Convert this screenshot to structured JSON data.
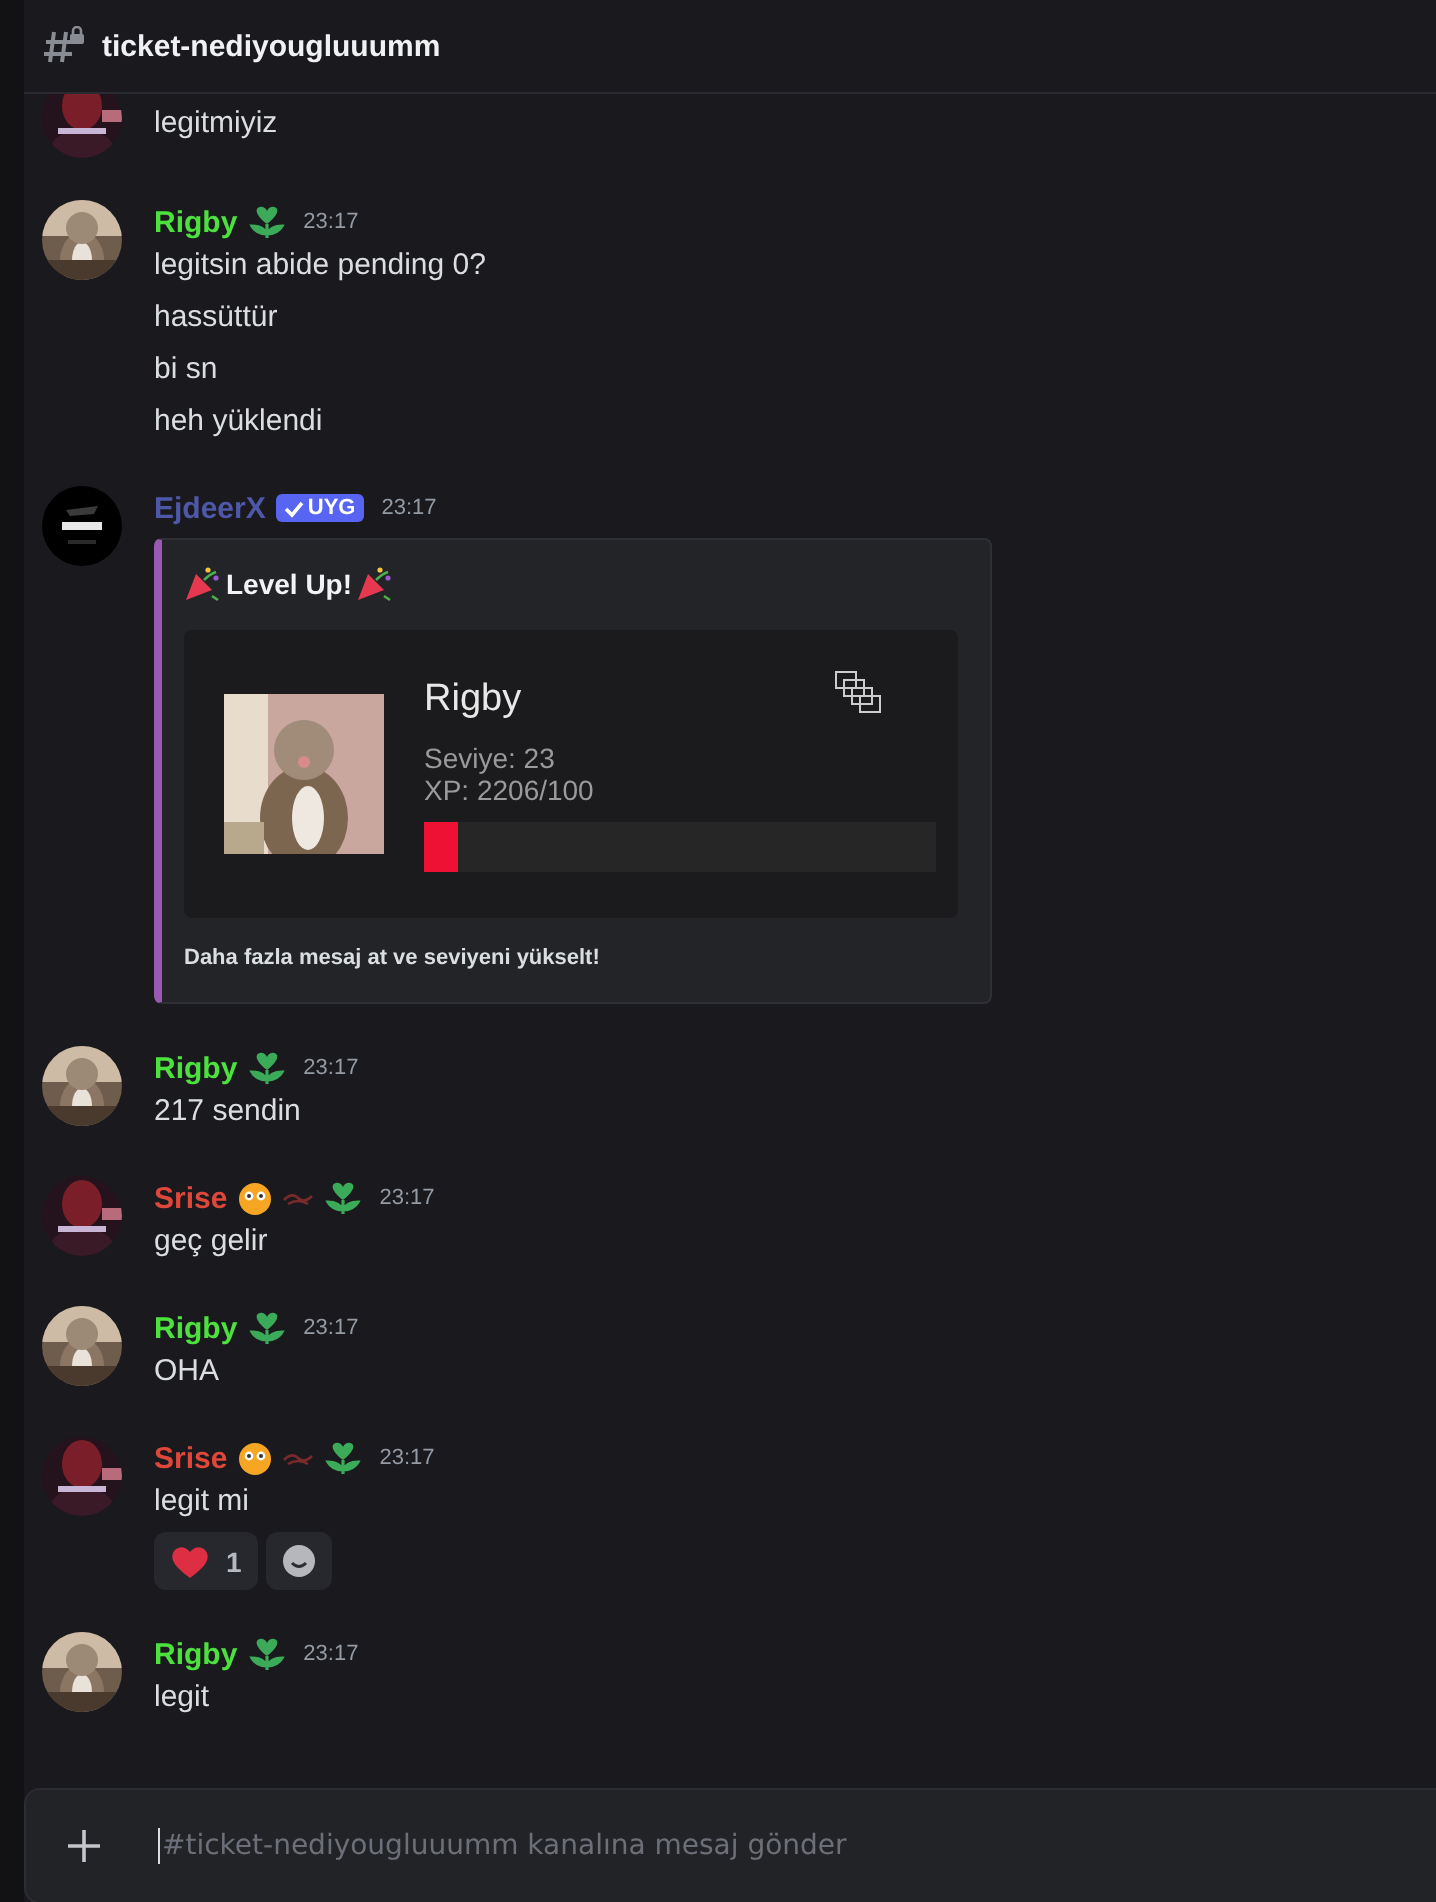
{
  "channel": {
    "name": "ticket-nediyougluuumm"
  },
  "messages": [
    {
      "kind": "girl",
      "lines": [
        "legitmiyiz"
      ]
    },
    {
      "kind": "cat",
      "author": "Rigby",
      "color": "#4ce13e",
      "time": "23:17",
      "lines": [
        "legitsin abide pending 0?",
        "hassüttür",
        "bi sn",
        "heh yüklendi"
      ]
    },
    {
      "kind": "bot",
      "author": "EjdeerX",
      "color": "#4e57a8",
      "tag": "UYG",
      "time": "23:17",
      "embed": {
        "title": "Level Up!",
        "card": {
          "name": "Rigby",
          "level_text": "Seviye: 23",
          "xp_text": "XP: 2206/100",
          "level": 0.065
        },
        "footer": "Daha fazla mesaj at ve seviyeni yükselt!"
      }
    },
    {
      "kind": "cat",
      "author": "Rigby",
      "color": "#4ce13e",
      "time": "23:17",
      "lines": [
        "217 sendin"
      ]
    },
    {
      "kind": "girl",
      "author": "Srise",
      "color": "#e0473b",
      "time": "23:17",
      "lines": [
        "geç gelir"
      ]
    },
    {
      "kind": "cat",
      "author": "Rigby",
      "color": "#4ce13e",
      "time": "23:17",
      "lines": [
        "OHA"
      ]
    },
    {
      "kind": "girl",
      "author": "Srise",
      "color": "#e0473b",
      "time": "23:17",
      "lines": [
        "legit mi"
      ],
      "reactions": [
        {
          "count": "1"
        }
      ]
    },
    {
      "kind": "cat",
      "author": "Rigby",
      "color": "#4ce13e",
      "time": "23:17",
      "lines": [
        "legit"
      ]
    }
  ],
  "composer": {
    "placeholder": "#ticket-nediyougluuumm kanalına mesaj gönder"
  }
}
